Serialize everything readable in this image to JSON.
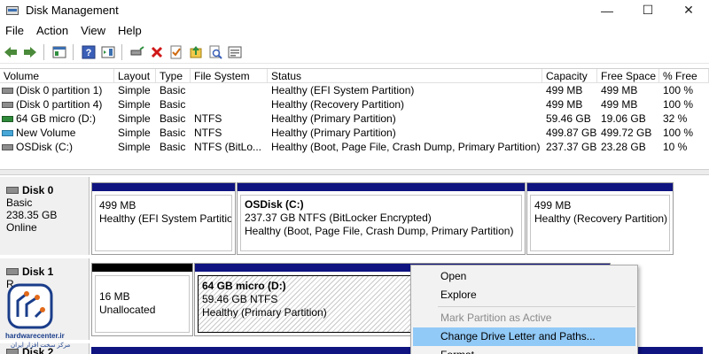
{
  "window": {
    "title": "Disk Management",
    "minimize": "—",
    "maximize": "☐",
    "close": "✕"
  },
  "menu": [
    "File",
    "Action",
    "View",
    "Help"
  ],
  "toolbar": {
    "icons": [
      "back-arrow-icon",
      "forward-arrow-icon",
      "show-hide-console-tree-icon",
      "help-icon",
      "action-pane-icon",
      "connect-drive-icon",
      "delete-icon",
      "check-icon",
      "import-icon",
      "search-disk-icon",
      "properties-icon"
    ]
  },
  "volume_table": {
    "columns": [
      "Volume",
      "Layout",
      "Type",
      "File System",
      "Status",
      "Capacity",
      "Free Space",
      "% Free"
    ],
    "rows": [
      {
        "volume": "(Disk 0 partition 1)",
        "layout": "Simple",
        "type": "Basic",
        "fs": "",
        "status": "Healthy (EFI System Partition)",
        "capacity": "499 MB",
        "free": "499 MB",
        "pct": "100 %",
        "icon": "drive-icon"
      },
      {
        "volume": "(Disk 0 partition 4)",
        "layout": "Simple",
        "type": "Basic",
        "fs": "",
        "status": "Healthy (Recovery Partition)",
        "capacity": "499 MB",
        "free": "499 MB",
        "pct": "100 %",
        "icon": "drive-icon"
      },
      {
        "volume": "64 GB micro (D:)",
        "layout": "Simple",
        "type": "Basic",
        "fs": "NTFS",
        "status": "Healthy (Primary Partition)",
        "capacity": "59.46 GB",
        "free": "19.06 GB",
        "pct": "32 %",
        "icon": "usb-drive-icon"
      },
      {
        "volume": "New Volume",
        "layout": "Simple",
        "type": "Basic",
        "fs": "NTFS",
        "status": "Healthy (Primary Partition)",
        "capacity": "499.87 GB",
        "free": "499.72 GB",
        "pct": "100 %",
        "icon": "volume-drive-icon"
      },
      {
        "volume": "OSDisk (C:)",
        "layout": "Simple",
        "type": "Basic",
        "fs": "NTFS (BitLo...",
        "status": "Healthy (Boot, Page File, Crash Dump, Primary Partition)",
        "capacity": "237.37 GB",
        "free": "23.28 GB",
        "pct": "10 %",
        "icon": "drive-icon"
      }
    ]
  },
  "disks": [
    {
      "name": "Disk 0",
      "lines": [
        "Basic",
        "238.35 GB",
        "Online"
      ],
      "partitions": [
        {
          "title": "",
          "size": "499 MB",
          "status": "Healthy (EFI System Partitio"
        },
        {
          "title": "OSDisk  (C:)",
          "size": "237.37 GB NTFS (BitLocker Encrypted)",
          "status": "Healthy (Boot, Page File, Crash Dump, Primary Partition)"
        },
        {
          "title": "",
          "size": "499 MB",
          "status": "Healthy (Recovery Partition)"
        }
      ]
    },
    {
      "name": "Disk 1",
      "lines": [
        "R"
      ],
      "partitions": [
        {
          "title": "",
          "size": "16 MB",
          "status": "Unallocated"
        },
        {
          "title": "64 GB micro  (D:)",
          "size": "59.46 GB NTFS",
          "status": "Healthy (Primary Partition)"
        }
      ]
    },
    {
      "name": "Disk 2",
      "lines": [],
      "partitions": []
    }
  ],
  "context_menu": {
    "items": [
      {
        "label": "Open",
        "disabled": false
      },
      {
        "label": "Explore",
        "disabled": false
      },
      {
        "label": "Mark Partition as Active",
        "disabled": true
      },
      {
        "label": "Change Drive Letter and Paths...",
        "disabled": false,
        "highlighted": true
      },
      {
        "label": "Format...",
        "disabled": false
      }
    ]
  },
  "watermark": {
    "line1": "hardwarecenter.ir",
    "line2": "مرکز سخت افزار ایران"
  },
  "colors": {
    "partition_bar": "#0f1480",
    "unallocated_bar": "#000000",
    "menu_highlight": "#91c9f7"
  }
}
